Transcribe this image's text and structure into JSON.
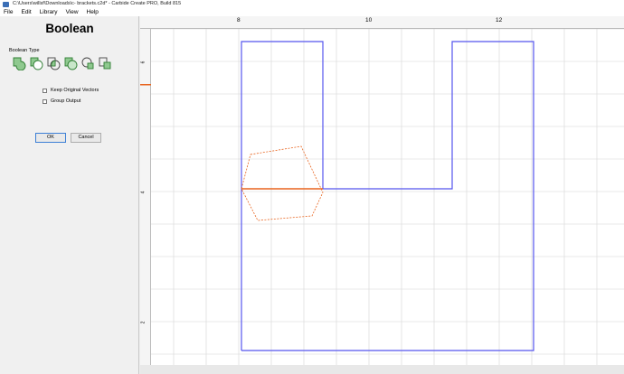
{
  "window": {
    "title": "C:\\Users\\willsf\\Downloads\\c- brackets.c2d* - Carbide Create PRO, Build 815"
  },
  "menu": [
    "File",
    "Edit",
    "Library",
    "View",
    "Help"
  ],
  "panel": {
    "title": "Boolean",
    "boolean_type_label": "Boolean Type",
    "keep_original_label": "Keep Original Vectors",
    "group_output_label": "Group Output",
    "ok_label": "OK",
    "cancel_label": "Cancel"
  },
  "ruler": {
    "top_labels": [
      "8",
      "10",
      "12"
    ],
    "left_labels": [
      "6",
      "4",
      "2"
    ]
  },
  "colors": {
    "selected_outline": "#5555ee",
    "active_vector": "#e8641e"
  },
  "icons": [
    "union-icon",
    "subtract-icon",
    "intersect-icon",
    "merge-icon",
    "split-icon",
    "exclude-icon"
  ]
}
